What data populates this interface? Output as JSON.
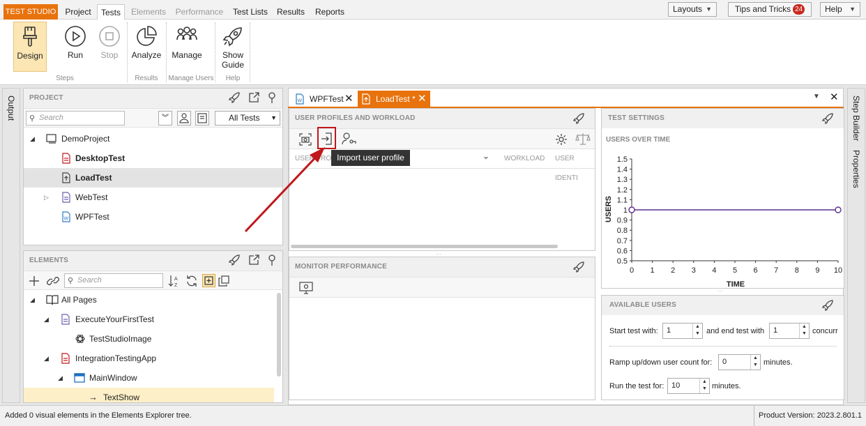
{
  "menubar": {
    "brand": "TEST STUDIO",
    "tabs": [
      "Project",
      "Tests",
      "Elements",
      "Performance",
      "Test Lists",
      "Results",
      "Reports"
    ],
    "layouts": "Layouts",
    "tips": "Tips and Tricks",
    "tips_count": "24",
    "help": "Help"
  },
  "ribbon": {
    "design": "Design",
    "run": "Run",
    "stop": "Stop",
    "analyze": "Analyze",
    "manage": "Manage",
    "guide_line1": "Show",
    "guide_line2": "Guide",
    "groups": [
      "Steps",
      "Results",
      "Manage Users",
      "Help"
    ]
  },
  "rails": {
    "output": "Output",
    "step_builder": "Step Builder",
    "properties": "Properties"
  },
  "project": {
    "title": "PROJECT",
    "search_placeholder": "Search",
    "filter": "All Tests",
    "root": "DemoProject",
    "items": [
      "DesktopTest",
      "LoadTest",
      "WebTest",
      "WPFTest"
    ]
  },
  "elements": {
    "title": "ELEMENTS",
    "search_placeholder": "Search",
    "items": [
      "All Pages",
      "ExecuteYourFirstTest",
      "TestStudioImage",
      "IntegrationTestingApp",
      "MainWindow",
      "TextShow"
    ]
  },
  "doc_tabs": {
    "tab1": "WPFTest",
    "tab2": "LoadTest",
    "tab2_dirty": "*"
  },
  "user_profiles": {
    "title": "USER PROFILES AND WORKLOAD",
    "col1": "USER PROFI",
    "col2": "WORKLOAD",
    "col3": "USER IDENTI"
  },
  "tooltip": "Import user profile",
  "monitor": {
    "title": "MONITOR PERFORMANCE"
  },
  "test_settings": {
    "title": "TEST SETTINGS",
    "subtitle": "USERS OVER TIME"
  },
  "available": {
    "title": "AVAILABLE USERS",
    "start_label": "Start test with:",
    "start_value": "1",
    "end_label": "and end test with",
    "end_value": "1",
    "concurrent_label": "concurr",
    "ramp_label": "Ramp up/down user count for:",
    "ramp_value": "0",
    "ramp_unit": "minutes.",
    "run_label": "Run the test for:",
    "run_value": "10",
    "run_unit": "minutes."
  },
  "status": {
    "message": "Added 0 visual elements in the Elements Explorer tree.",
    "version": "Product Version: 2023.2.801.1"
  },
  "chart_data": {
    "type": "line",
    "title": "USERS OVER TIME",
    "xlabel": "TIME",
    "ylabel": "USERS",
    "xlim": [
      0,
      10
    ],
    "ylim": [
      0.5,
      1.5
    ],
    "x_ticks": [
      0,
      1,
      2,
      3,
      4,
      5,
      6,
      7,
      8,
      9,
      10
    ],
    "y_ticks": [
      0.5,
      0.6,
      0.7,
      0.8,
      0.9,
      1,
      1.1,
      1.2,
      1.3,
      1.4,
      1.5
    ],
    "series": [
      {
        "x": [
          0,
          10
        ],
        "values": [
          1,
          1
        ]
      }
    ],
    "colors": {
      "line": "#5b2d8e"
    }
  },
  "colors": {
    "brand": "#e8720c",
    "accent_highlight": "#c0171b",
    "selected": "#fbe6b4"
  }
}
